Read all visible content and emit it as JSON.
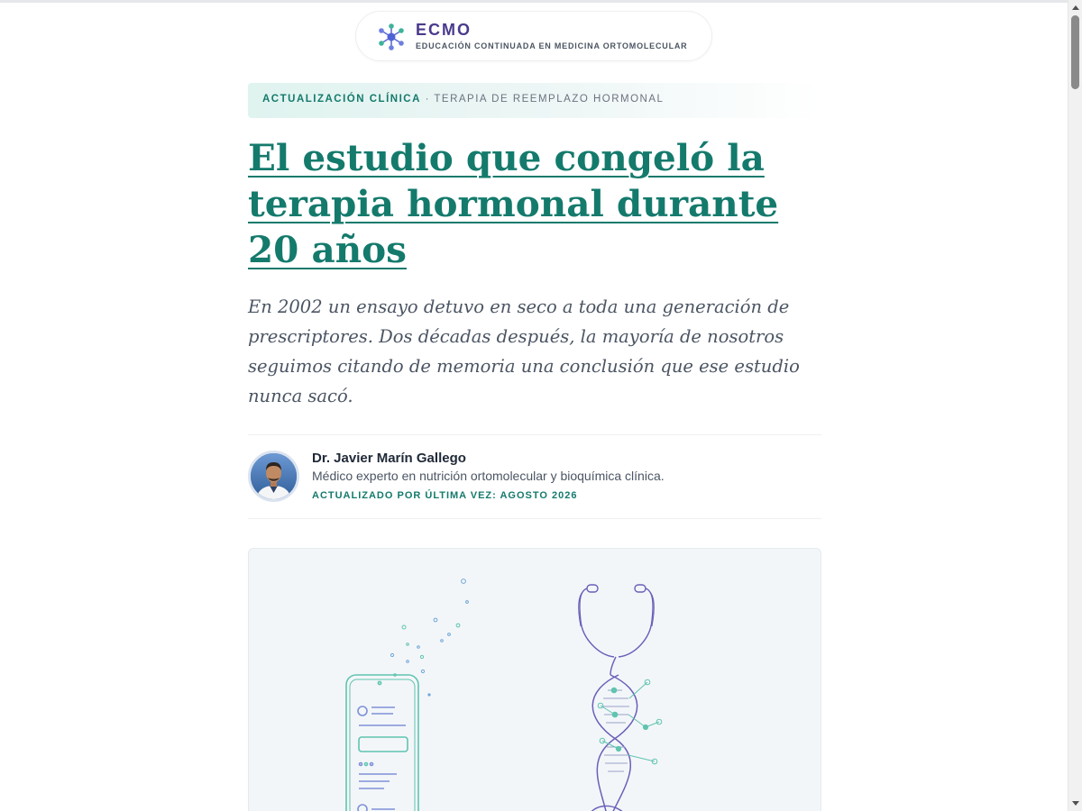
{
  "brand": {
    "name": "ECMO",
    "tagline": "EDUCACIÓN CONTINUADA EN MEDICINA ORTOMOLECULAR",
    "logo_icon": "molecule-icon"
  },
  "kicker": {
    "primary": "ACTUALIZACIÓN CLÍNICA",
    "separator": " · ",
    "secondary": "TERAPIA DE REEMPLAZO HORMONAL"
  },
  "article": {
    "title": "El estudio que congeló la terapia hormonal durante 20 años",
    "lede": "En 2002 un ensayo detuvo en seco a toda una generación de prescriptores. Dos décadas después, la mayoría de nosotros seguimos citando de memoria una conclusión que ese estudio nunca sacó."
  },
  "author": {
    "name": "Dr. Javier Marín Gallego",
    "bio": "Médico experto en nutrición ortomolecular y bioquímica clínica.",
    "updated": "ACTUALIZADO POR ÚLTIMA VEZ: AGOSTO 2026"
  },
  "hero": {
    "illustration": "phone-stethoscope-dna-illustration"
  },
  "colors": {
    "accent": "#147a6c",
    "brand": "#4a3a8c",
    "text": "#1f2937",
    "muted": "#4b5563",
    "hero_bg": "#f3f6f9"
  }
}
